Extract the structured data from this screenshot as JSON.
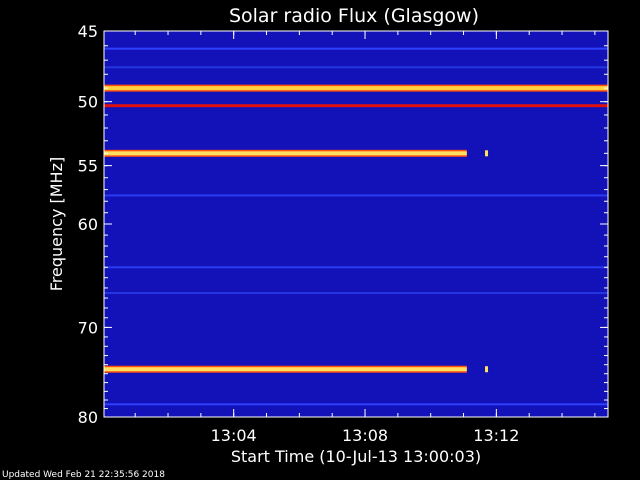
{
  "chart_data": {
    "type": "heatmap",
    "title": "Solar radio Flux (Glasgow)",
    "xlabel": "Start Time (10-Jul-13 13:00:03)",
    "ylabel": "Frequency [MHz]",
    "x_range_minutes": [
      0.05,
      15.4
    ],
    "y_range_mhz": [
      45,
      80
    ],
    "x_ticks": [
      {
        "minute": 4,
        "label": "13:04"
      },
      {
        "minute": 8,
        "label": "13:08"
      },
      {
        "minute": 12,
        "label": "13:12"
      }
    ],
    "y_ticks": [
      {
        "mhz": 45,
        "label": "45"
      },
      {
        "mhz": 50,
        "label": "50"
      },
      {
        "mhz": 55,
        "label": "55"
      },
      {
        "mhz": 60,
        "label": "60"
      },
      {
        "mhz": 70,
        "label": "70"
      },
      {
        "mhz": 80,
        "label": "80"
      }
    ],
    "background_color": "#1212b8",
    "bands": [
      {
        "mhz": 49.0,
        "start_min": 0.05,
        "end_min": 15.4,
        "intensity": "high",
        "color": "#ffd040"
      },
      {
        "mhz": 50.3,
        "start_min": 0.05,
        "end_min": 15.4,
        "intensity": "medium",
        "color": "#e01010"
      },
      {
        "mhz": 54.0,
        "start_min": 0.05,
        "end_min": 11.1,
        "intensity": "high",
        "color": "#ffe060"
      },
      {
        "mhz": 74.5,
        "start_min": 0.05,
        "end_min": 11.1,
        "intensity": "high",
        "color": "#ffe060"
      },
      {
        "mhz": 46.2,
        "start_min": 0.05,
        "end_min": 15.4,
        "intensity": "low",
        "color": "#3040ff"
      },
      {
        "mhz": 47.5,
        "start_min": 0.05,
        "end_min": 15.4,
        "intensity": "low",
        "color": "#2535e0"
      },
      {
        "mhz": 57.5,
        "start_min": 0.05,
        "end_min": 15.4,
        "intensity": "low",
        "color": "#2a3cf0"
      },
      {
        "mhz": 64.0,
        "start_min": 0.05,
        "end_min": 15.4,
        "intensity": "low",
        "color": "#2a3cf0"
      },
      {
        "mhz": 66.5,
        "start_min": 0.05,
        "end_min": 15.4,
        "intensity": "low",
        "color": "#2535e0"
      },
      {
        "mhz": 78.5,
        "start_min": 0.05,
        "end_min": 15.4,
        "intensity": "low",
        "color": "#3040ff"
      }
    ],
    "band_colors": {
      "bright": "#ffe060",
      "red": "#e01010",
      "faint": "#2a3cf0"
    },
    "bursts": [
      {
        "mhz": 54.0,
        "minute": 11.7
      },
      {
        "mhz": 74.5,
        "minute": 11.7
      }
    ]
  },
  "footer": {
    "updated": "Updated Wed Feb 21 22:35:56 2018"
  }
}
